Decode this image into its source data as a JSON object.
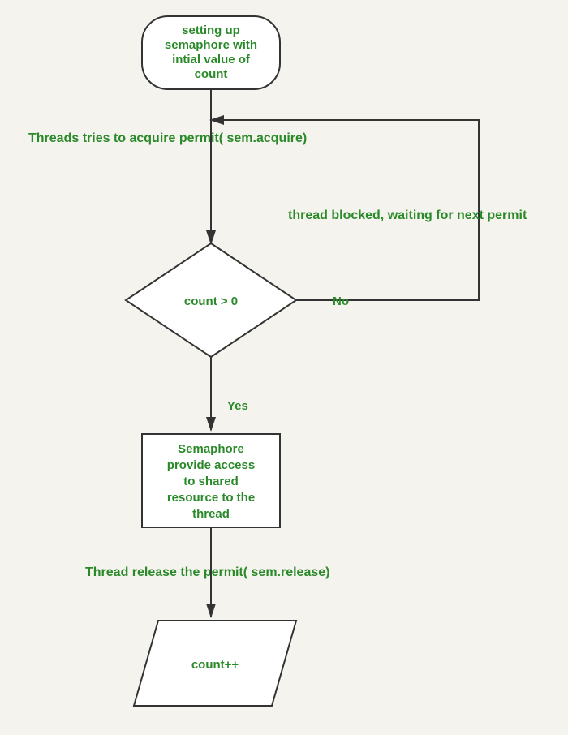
{
  "diagram": {
    "start": {
      "line1": "setting up",
      "line2": "semaphore with",
      "line3": "intial value of",
      "line4": "count"
    },
    "acquire_label": "Threads tries to acquire permit( sem.acquire)",
    "decision": "count > 0",
    "no_label": "No",
    "yes_label": "Yes",
    "blocked_label": "thread blocked, waiting for next permit",
    "process": {
      "line1": "Semaphore",
      "line2": "provide access",
      "line3": "to shared",
      "line4": "resource to the",
      "line5": "thread"
    },
    "release_label": "Thread release the permit( sem.release)",
    "final": "count++"
  }
}
